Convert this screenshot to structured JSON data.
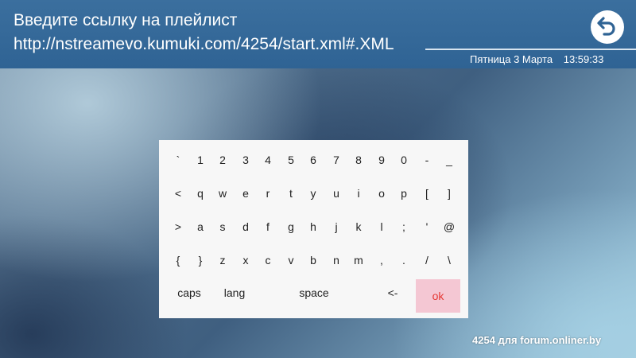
{
  "header": {
    "title": "Введите ссылку на плейлист",
    "url": "http://nstreamevo.kumuki.com/4254/start.xml#.XML",
    "date": "Пятница 3 Марта",
    "time": "13:59:33",
    "back_icon": "back-arrow-icon"
  },
  "keyboard": {
    "rows": [
      [
        "`",
        "1",
        "2",
        "3",
        "4",
        "5",
        "6",
        "7",
        "8",
        "9",
        "0",
        "-",
        "_"
      ],
      [
        "<",
        "q",
        "w",
        "e",
        "r",
        "t",
        "y",
        "u",
        "i",
        "o",
        "p",
        "[",
        "]"
      ],
      [
        ">",
        "a",
        "s",
        "d",
        "f",
        "g",
        "h",
        "j",
        "k",
        "l",
        ";",
        "'",
        "@"
      ],
      [
        "{",
        "}",
        "z",
        "x",
        "c",
        "v",
        "b",
        "n",
        "m",
        ",",
        ".",
        "/",
        "\\"
      ]
    ],
    "bottom": {
      "caps": "caps",
      "lang": "lang",
      "space": "space",
      "backspace": "<-",
      "ok": "ok"
    },
    "ok_bg_color": "#f4c7d3",
    "ok_text_color": "#e53935"
  },
  "watermark": "4254 для forum.onliner.by"
}
